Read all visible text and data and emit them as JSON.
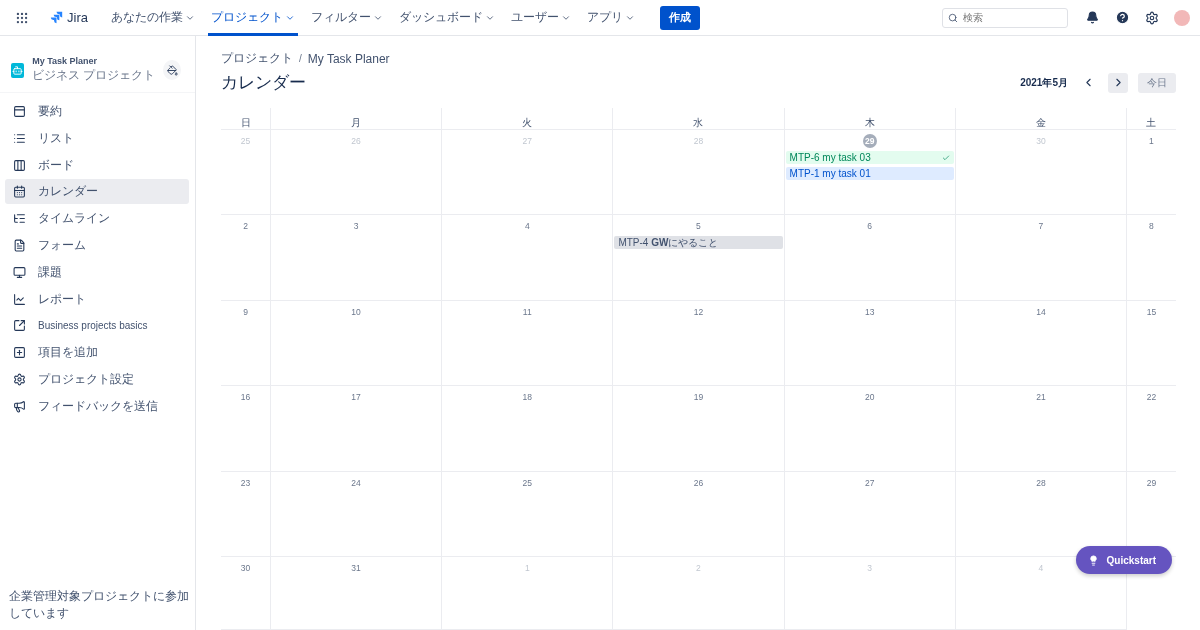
{
  "topbar": {
    "product": "Jira",
    "nav": [
      {
        "label": "あなたの作業",
        "selected": false
      },
      {
        "label": "プロジェクト",
        "selected": true
      },
      {
        "label": "フィルター",
        "selected": false
      },
      {
        "label": "ダッシュボード",
        "selected": false
      },
      {
        "label": "ユーザー",
        "selected": false
      },
      {
        "label": "アプリ",
        "selected": false
      }
    ],
    "create": "作成",
    "search": {
      "placeholder": "検索"
    }
  },
  "sidebar": {
    "project": {
      "name": "My Task Planer",
      "type": "ビジネス プロジェクト"
    },
    "items": [
      {
        "label": "要約",
        "selected": false
      },
      {
        "label": "リスト",
        "selected": false
      },
      {
        "label": "ボード",
        "selected": false
      },
      {
        "label": "カレンダー",
        "selected": true
      },
      {
        "label": "タイムライン",
        "selected": false
      },
      {
        "label": "フォーム",
        "selected": false
      },
      {
        "label": "課題",
        "selected": false
      },
      {
        "label": "レポート",
        "selected": false
      },
      {
        "label": "Business projects basics",
        "selected": false
      },
      {
        "label": "項目を追加",
        "selected": false
      },
      {
        "label": "プロジェクト設定",
        "selected": false
      },
      {
        "label": "フィードバックを送信",
        "selected": false
      }
    ],
    "footer": "企業管理対象プロジェクトに参加しています"
  },
  "breadcrumb": {
    "items": [
      "プロジェクト",
      "My Task Planer"
    ],
    "separator": "/"
  },
  "title": "カレンダー",
  "month": "2021年5月",
  "today_button": "今日",
  "weekdays": [
    "日",
    "月",
    "火",
    "水",
    "木",
    "金",
    "土"
  ],
  "weeks": [
    [
      {
        "label": "25",
        "muted": true,
        "today": false
      },
      {
        "label": "26",
        "muted": true,
        "today": false
      },
      {
        "label": "27",
        "muted": true,
        "today": false
      },
      {
        "label": "28",
        "muted": true,
        "today": false
      },
      {
        "label": "29",
        "muted": true,
        "today": true,
        "events": [
          {
            "text": "MTP-6 my task 03",
            "kind": "done"
          },
          {
            "text": "MTP-1 my task 01",
            "kind": "progress"
          }
        ]
      },
      {
        "label": "30",
        "muted": true,
        "today": false
      },
      {
        "label": "1",
        "muted": false,
        "today": false
      }
    ],
    [
      {
        "label": "2",
        "muted": false,
        "today": false
      },
      {
        "label": "3",
        "muted": false,
        "today": false
      },
      {
        "label": "4",
        "muted": false,
        "today": false
      },
      {
        "label": "5",
        "muted": false,
        "today": false,
        "events": [
          {
            "text": "MTP-4 **GW**にやること",
            "kind": "todo"
          }
        ]
      },
      {
        "label": "6",
        "muted": false,
        "today": false
      },
      {
        "label": "7",
        "muted": false,
        "today": false
      },
      {
        "label": "8",
        "muted": false,
        "today": false
      }
    ],
    [
      {
        "label": "9",
        "muted": false,
        "today": false
      },
      {
        "label": "10",
        "muted": false,
        "today": false
      },
      {
        "label": "11",
        "muted": false,
        "today": false
      },
      {
        "label": "12",
        "muted": false,
        "today": false
      },
      {
        "label": "13",
        "muted": false,
        "today": false
      },
      {
        "label": "14",
        "muted": false,
        "today": false
      },
      {
        "label": "15",
        "muted": false,
        "today": false
      }
    ],
    [
      {
        "label": "16",
        "muted": false,
        "today": false
      },
      {
        "label": "17",
        "muted": false,
        "today": false
      },
      {
        "label": "18",
        "muted": false,
        "today": false
      },
      {
        "label": "19",
        "muted": false,
        "today": false
      },
      {
        "label": "20",
        "muted": false,
        "today": false
      },
      {
        "label": "21",
        "muted": false,
        "today": false
      },
      {
        "label": "22",
        "muted": false,
        "today": false
      }
    ],
    [
      {
        "label": "23",
        "muted": false,
        "today": false
      },
      {
        "label": "24",
        "muted": false,
        "today": false
      },
      {
        "label": "25",
        "muted": false,
        "today": false
      },
      {
        "label": "26",
        "muted": false,
        "today": false
      },
      {
        "label": "27",
        "muted": false,
        "today": false
      },
      {
        "label": "28",
        "muted": false,
        "today": false
      },
      {
        "label": "29",
        "muted": false,
        "today": false
      }
    ],
    [
      {
        "label": "30",
        "muted": false,
        "today": false
      },
      {
        "label": "31",
        "muted": false,
        "today": false
      },
      {
        "label": "1",
        "muted": true,
        "today": false
      },
      {
        "label": "2",
        "muted": true,
        "today": false
      },
      {
        "label": "3",
        "muted": true,
        "today": false
      },
      {
        "label": "4",
        "muted": true,
        "today": false
      }
    ]
  ],
  "quickstart": "Quickstart"
}
